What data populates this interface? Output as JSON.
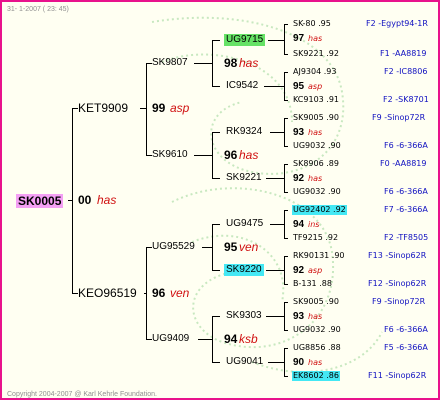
{
  "header": {
    "date": "31- 1-2007 ( 23: 45)"
  },
  "footer": {
    "copyright": "Copyright 2004-2007 @ Karl Kehrle Foundation."
  },
  "root": {
    "id": "SK0005",
    "num": "00",
    "tag": "has"
  },
  "gen1": [
    {
      "id": "KET9909",
      "num": "99",
      "tag": "asp"
    },
    {
      "id": "KEO96519",
      "num": "96",
      "tag": "ven"
    }
  ],
  "gen2": [
    {
      "id": "SK9807",
      "num": "98",
      "tag": "has"
    },
    {
      "id": "SK9610",
      "num": "96",
      "tag": "has"
    },
    {
      "id": "UG95529",
      "num": "95",
      "tag": "ven"
    },
    {
      "id": "UG9409",
      "num": "94",
      "tag": "ksb"
    }
  ],
  "gen3": [
    {
      "id": "UG9715"
    },
    {
      "id": "IC9542"
    },
    {
      "id": "RK9324"
    },
    {
      "id": "SK9221"
    },
    {
      "id": "UG9475"
    },
    {
      "id": "SK9220"
    },
    {
      "id": "SK9303"
    },
    {
      "id": "UG9041"
    }
  ],
  "gen4": [
    {
      "top": "SK-80 .95",
      "num": "97",
      "tag": "has",
      "bottom": "SK9221 .92",
      "top_line": "F2 -Egypt94-1R",
      "bottom_line": "F1 -AA8819"
    },
    {
      "top": "AJ9304 .93",
      "num": "95",
      "tag": "asp",
      "bottom": "KC9103 .91",
      "top_line": "F2 -IC8806",
      "bottom_line": "F2 -SK8701"
    },
    {
      "top": "SK9005 .90",
      "num": "93",
      "tag": "has",
      "bottom": "UG9032 .90",
      "top_line": "F9 -Sinop72R",
      "bottom_line": "F6 -6-366A"
    },
    {
      "top": "SK8906 .89",
      "num": "92",
      "tag": "has",
      "bottom": "UG9032 .90",
      "top_line": "F0 -AA8819",
      "bottom_line": "F6 -6-366A"
    },
    {
      "top": "UG92402 .92",
      "num": "94",
      "tag": "ins",
      "bottom": "TF9215 .92",
      "top_line": "F7 -6-366A",
      "bottom_line": "F2 -TF8505"
    },
    {
      "top": "RK90131 .90",
      "num": "92",
      "tag": "asp",
      "bottom": "B-131 .88",
      "top_line": "F13 -Sinop62R",
      "bottom_line": "F12 -Sinop62R"
    },
    {
      "top": "SK9005 .90",
      "num": "93",
      "tag": "has",
      "bottom": "UG9032 .90",
      "top_line": "F9 -Sinop72R",
      "bottom_line": "F6 -6-366A"
    },
    {
      "top": "UG8856 .88",
      "num": "90",
      "tag": "has",
      "bottom": "EK8602 .86",
      "top_line": "F5 -6-366A",
      "bottom_line": "F11 -Sinop62R"
    }
  ],
  "colors": {
    "border": "#e8128c",
    "tag_red": "#d01010",
    "line_blue": "#1010c0",
    "hl_root": "#f4a0f4",
    "hl_green": "#66e266",
    "hl_cyan": "#44e8f4"
  }
}
